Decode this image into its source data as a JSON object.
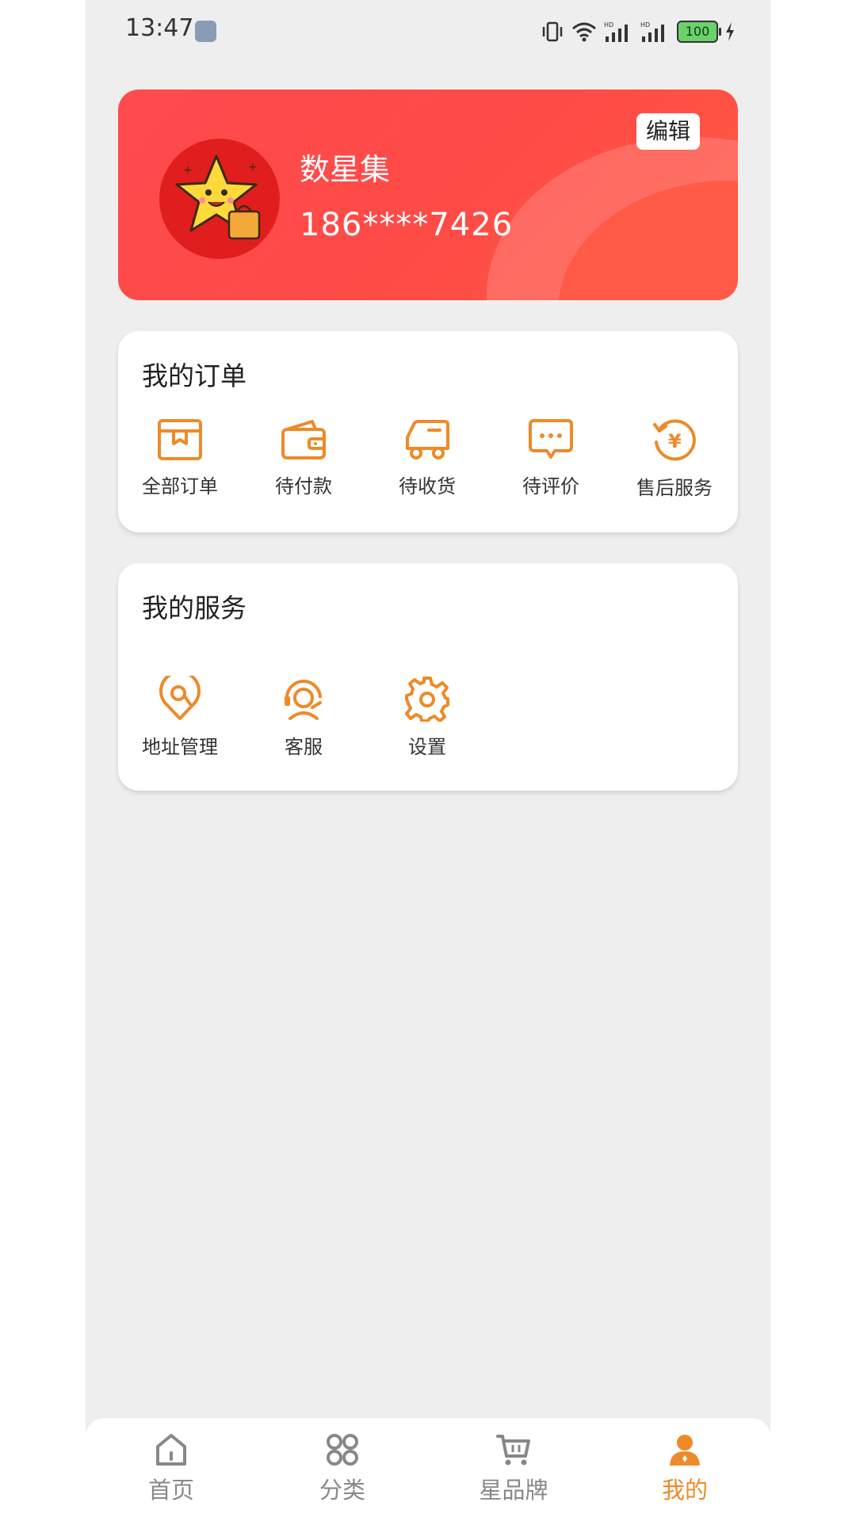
{
  "status_bar": {
    "time": "13:47",
    "battery": "100"
  },
  "profile": {
    "name": "数星集",
    "phone": "186****7426",
    "edit_label": "编辑"
  },
  "orders": {
    "title": "我的订单",
    "items": [
      {
        "label": "全部订单",
        "icon": "package-icon"
      },
      {
        "label": "待付款",
        "icon": "wallet-icon"
      },
      {
        "label": "待收货",
        "icon": "truck-icon"
      },
      {
        "label": "待评价",
        "icon": "chat-icon"
      },
      {
        "label": "售后服务",
        "icon": "refund-icon"
      }
    ]
  },
  "services": {
    "title": "我的服务",
    "items": [
      {
        "label": "地址管理",
        "icon": "location-icon"
      },
      {
        "label": "客服",
        "icon": "customer-service-icon"
      },
      {
        "label": "设置",
        "icon": "gear-icon"
      }
    ]
  },
  "nav": {
    "items": [
      {
        "label": "首页",
        "icon": "home-icon"
      },
      {
        "label": "分类",
        "icon": "category-icon"
      },
      {
        "label": "星品牌",
        "icon": "cart-icon"
      },
      {
        "label": "我的",
        "icon": "user-icon",
        "active": true
      }
    ]
  },
  "colors": {
    "accent": "#ee8a28",
    "card_red": "#ff4b4b",
    "background": "#eeeeee"
  }
}
